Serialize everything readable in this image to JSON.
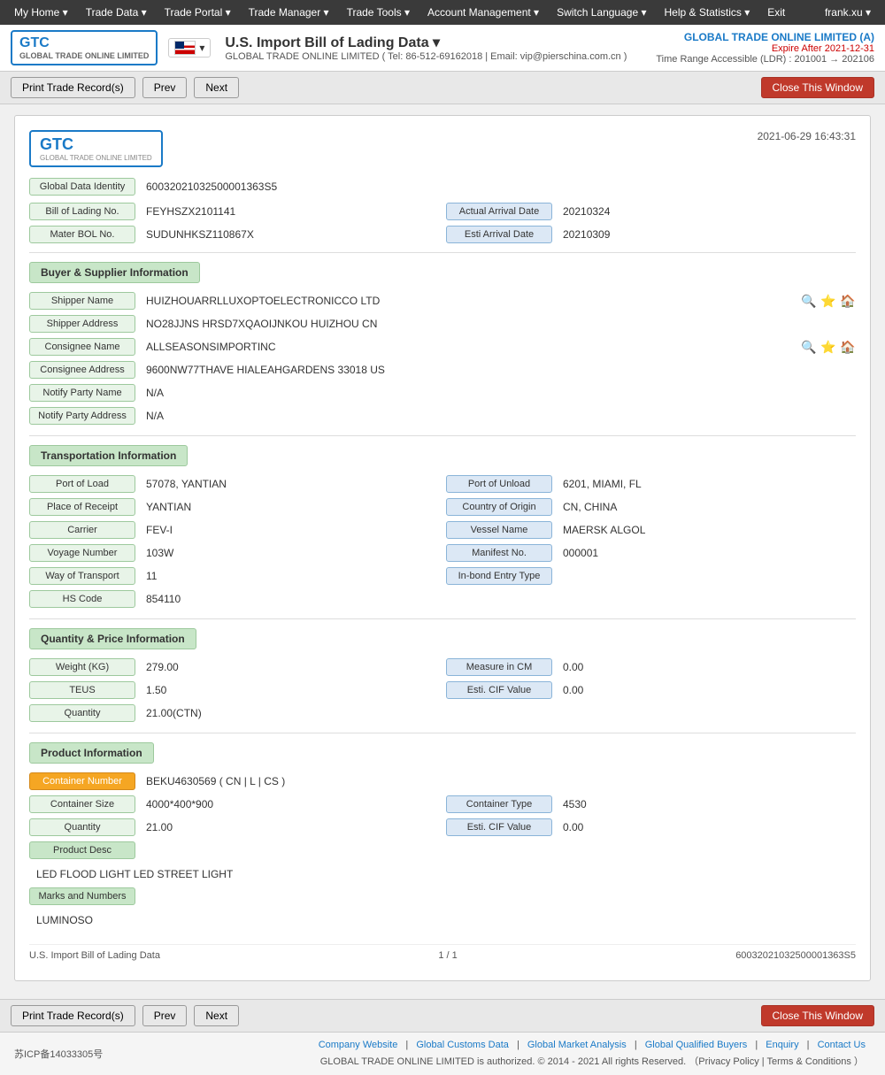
{
  "nav": {
    "items": [
      {
        "label": "My Home ▾",
        "name": "my-home"
      },
      {
        "label": "Trade Data ▾",
        "name": "trade-data"
      },
      {
        "label": "Trade Portal ▾",
        "name": "trade-portal"
      },
      {
        "label": "Trade Manager ▾",
        "name": "trade-manager"
      },
      {
        "label": "Trade Tools ▾",
        "name": "trade-tools"
      },
      {
        "label": "Account Management ▾",
        "name": "account-management"
      },
      {
        "label": "Switch Language ▾",
        "name": "switch-language"
      },
      {
        "label": "Help & Statistics ▾",
        "name": "help-statistics"
      },
      {
        "label": "Exit",
        "name": "exit"
      }
    ],
    "user": "frank.xu ▾"
  },
  "header": {
    "logo_text": "GTC",
    "logo_sub": "GLOBAL TRADE ONLINE LIMITED",
    "title": "U.S. Import Bill of Lading Data ▾",
    "subtitle": "GLOBAL TRADE ONLINE LIMITED ( Tel: 86-512-69162018 | Email: vip@pierschina.com.cn )",
    "company": "GLOBAL TRADE ONLINE LIMITED (A)",
    "expire": "Expire After 2021-12-31",
    "range": "Time Range Accessible (LDR) : 201001 → 202106"
  },
  "toolbar": {
    "print_label": "Print Trade Record(s)",
    "prev_label": "Prev",
    "next_label": "Next",
    "close_label": "Close This Window"
  },
  "card": {
    "date": "2021-06-29 16:43:31",
    "global_data_identity_label": "Global Data Identity",
    "global_data_identity_value": "60032021032500001363S5",
    "bill_of_lading_label": "Bill of Lading No.",
    "bill_of_lading_value": "FEYHSZX2101141",
    "actual_arrival_label": "Actual Arrival Date",
    "actual_arrival_value": "20210324",
    "mater_bol_label": "Mater BOL No.",
    "mater_bol_value": "SUDUNHKSZ110867X",
    "esti_arrival_label": "Esti Arrival Date",
    "esti_arrival_value": "20210309",
    "buyer_supplier_header": "Buyer & Supplier Information",
    "shipper_name_label": "Shipper Name",
    "shipper_name_value": "HUIZHOUARRLLUXOPTOELECTRONICCO LTD",
    "shipper_address_label": "Shipper Address",
    "shipper_address_value": "NO28JJNS HRSD7XQAOIJNKOU HUIZHOU CN",
    "consignee_name_label": "Consignee Name",
    "consignee_name_value": "ALLSEASONSIMPORTINC",
    "consignee_address_label": "Consignee Address",
    "consignee_address_value": "9600NW77THAVE HIALEAHGARDENS 33018 US",
    "notify_party_name_label": "Notify Party Name",
    "notify_party_name_value": "N/A",
    "notify_party_address_label": "Notify Party Address",
    "notify_party_address_value": "N/A",
    "transport_header": "Transportation Information",
    "port_of_load_label": "Port of Load",
    "port_of_load_value": "57078, YANTIAN",
    "port_of_unload_label": "Port of Unload",
    "port_of_unload_value": "6201, MIAMI, FL",
    "place_of_receipt_label": "Place of Receipt",
    "place_of_receipt_value": "YANTIAN",
    "country_of_origin_label": "Country of Origin",
    "country_of_origin_value": "CN, CHINA",
    "carrier_label": "Carrier",
    "carrier_value": "FEV-I",
    "vessel_name_label": "Vessel Name",
    "vessel_name_value": "MAERSK ALGOL",
    "voyage_number_label": "Voyage Number",
    "voyage_number_value": "103W",
    "manifest_no_label": "Manifest No.",
    "manifest_no_value": "000001",
    "way_of_transport_label": "Way of Transport",
    "way_of_transport_value": "11",
    "inbond_entry_label": "In-bond Entry Type",
    "inbond_entry_value": "",
    "hs_code_label": "HS Code",
    "hs_code_value": "854110",
    "quantity_price_header": "Quantity & Price Information",
    "weight_kg_label": "Weight (KG)",
    "weight_kg_value": "279.00",
    "measure_in_cm_label": "Measure in CM",
    "measure_in_cm_value": "0.00",
    "teus_label": "TEUS",
    "teus_value": "1.50",
    "esti_cif_label": "Esti. CIF Value",
    "esti_cif_value": "0.00",
    "quantity_label": "Quantity",
    "quantity_value": "21.00(CTN)",
    "product_header": "Product Information",
    "container_number_label": "Container Number",
    "container_number_value": "BEKU4630569 ( CN | L | CS )",
    "container_size_label": "Container Size",
    "container_size_value": "4000*400*900",
    "container_type_label": "Container Type",
    "container_type_value": "4530",
    "product_quantity_label": "Quantity",
    "product_quantity_value": "21.00",
    "product_esti_cif_label": "Esti. CIF Value",
    "product_esti_cif_value": "0.00",
    "product_desc_label": "Product Desc",
    "product_desc_value": "LED FLOOD LIGHT LED STREET LIGHT",
    "marks_numbers_label": "Marks and Numbers",
    "marks_numbers_value": "LUMINOSO",
    "page_title_bottom": "U.S. Import Bill of Lading Data",
    "page_count": "1 / 1",
    "global_id_bottom": "60032021032500001363S5"
  },
  "bottom_toolbar": {
    "print_label": "Print Trade Record(s)",
    "prev_label": "Prev",
    "next_label": "Next",
    "close_label": "Close This Window"
  },
  "footer": {
    "icp": "苏ICP备14033305号",
    "links": [
      "Company Website",
      "Global Customs Data",
      "Global Market Analysis",
      "Global Qualified Buyers",
      "Enquiry",
      "Contact Us"
    ],
    "copyright": "GLOBAL TRADE ONLINE LIMITED is authorized. © 2014 - 2021 All rights Reserved. （Privacy Policy | Terms & Conditions ）"
  }
}
